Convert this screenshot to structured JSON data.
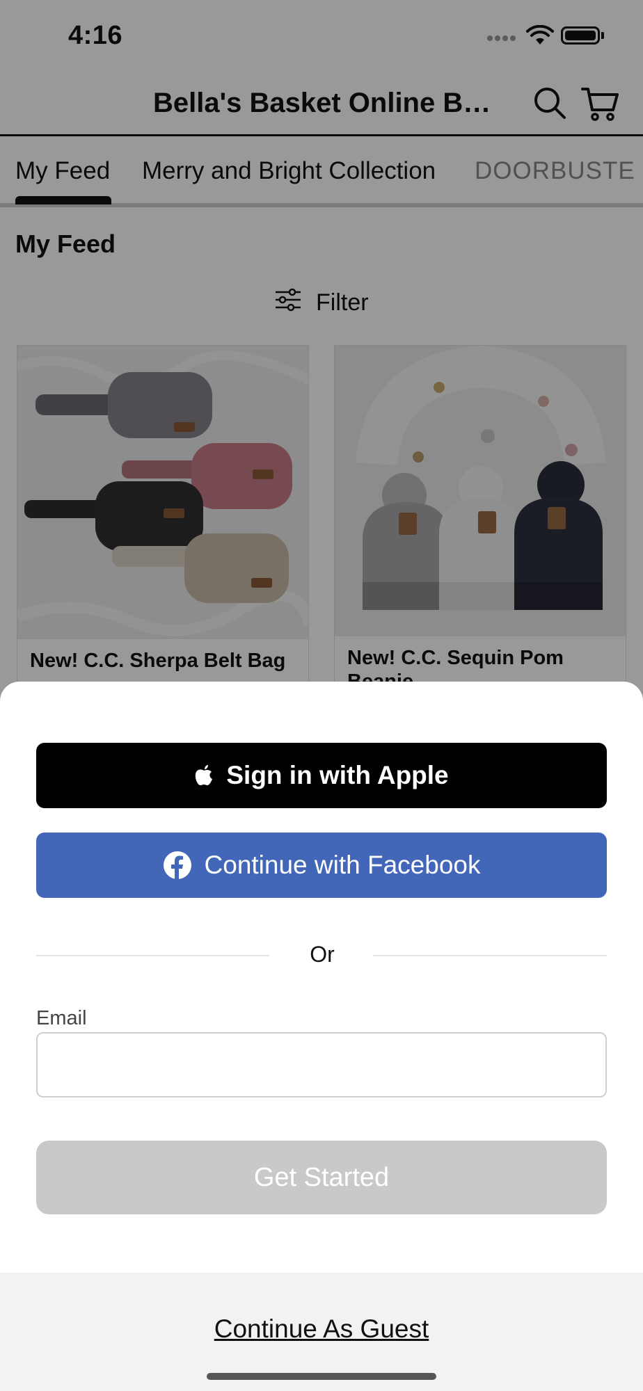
{
  "status_bar": {
    "time": "4:16"
  },
  "header": {
    "title": "Bella's Basket Online Bo..."
  },
  "tabs": [
    {
      "label": "My Feed",
      "active": true
    },
    {
      "label": "Merry and Bright Collection",
      "active": false
    },
    {
      "label": "DOORBUSTE",
      "active": false
    }
  ],
  "feed": {
    "heading": "My Feed",
    "filter_label": "Filter",
    "products": [
      {
        "title": "New! C.C. Sherpa Belt Bag"
      },
      {
        "title": "New! C.C. Sequin Pom Beanie"
      }
    ]
  },
  "sheet": {
    "apple_label": "Sign in with Apple",
    "facebook_label": "Continue with Facebook",
    "or_text": "Or",
    "email_label": "Email",
    "email_value": "",
    "email_placeholder": "",
    "get_started_label": "Get Started",
    "guest_label": "Continue As Guest"
  },
  "colors": {
    "facebook_blue": "#4267b8",
    "apple_black": "#000000",
    "disabled_gray": "#c9c9c9",
    "overlay": "rgba(0,0,0,0.40)"
  },
  "icons": [
    "wifi-icon",
    "battery-icon",
    "search-icon",
    "cart-icon",
    "filter-icon",
    "apple-icon",
    "facebook-icon"
  ]
}
